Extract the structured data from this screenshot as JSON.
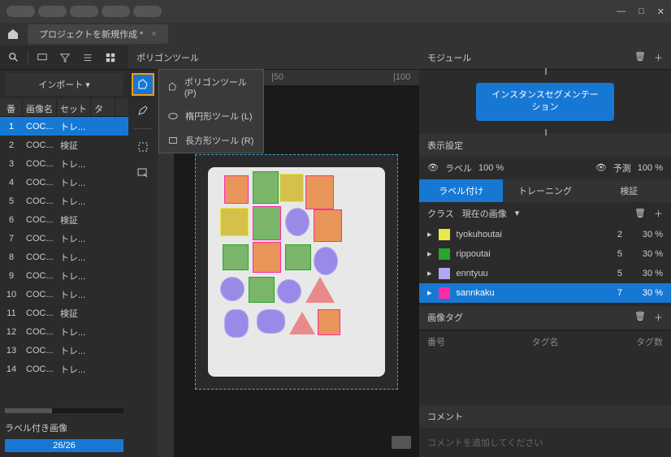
{
  "titlebar": {
    "min": "—",
    "max": "□",
    "close": "✕"
  },
  "tab": {
    "title": "プロジェクトを新規作成 *"
  },
  "left": {
    "import": "インポート ▾",
    "headers": {
      "num": "番号",
      "name": "画像名",
      "set": "セット",
      "tag": "タグ"
    },
    "rows": [
      {
        "n": "1",
        "name": "COC...",
        "set": "トレ...",
        "sel": true
      },
      {
        "n": "2",
        "name": "COC...",
        "set": "検証"
      },
      {
        "n": "3",
        "name": "COC...",
        "set": "トレ..."
      },
      {
        "n": "4",
        "name": "COC...",
        "set": "トレ..."
      },
      {
        "n": "5",
        "name": "COC...",
        "set": "トレ..."
      },
      {
        "n": "6",
        "name": "COC...",
        "set": "検証"
      },
      {
        "n": "7",
        "name": "COC...",
        "set": "トレ..."
      },
      {
        "n": "8",
        "name": "COC...",
        "set": "トレ..."
      },
      {
        "n": "9",
        "name": "COC...",
        "set": "トレ..."
      },
      {
        "n": "10",
        "name": "COC...",
        "set": "トレ..."
      },
      {
        "n": "11",
        "name": "COC...",
        "set": "検証"
      },
      {
        "n": "12",
        "name": "COC...",
        "set": "トレ..."
      },
      {
        "n": "13",
        "name": "COC...",
        "set": "トレ..."
      },
      {
        "n": "14",
        "name": "COC...",
        "set": "トレ..."
      }
    ],
    "footer": "ラベル付き画像",
    "progress": "26/26"
  },
  "center": {
    "toolname": "ポリゴンツール",
    "ruler": [
      "|50",
      "|100"
    ],
    "dropdown": [
      {
        "label": "ポリゴンツール (P)"
      },
      {
        "label": "楕円形ツール (L)"
      },
      {
        "label": "長方形ツール (R)"
      }
    ]
  },
  "right": {
    "module": "モジュール",
    "chip": "インスタンスセグメンテーション",
    "display": "表示設定",
    "label": "ラベル",
    "labelPct": "100 %",
    "pred": "予測",
    "predPct": "100 %",
    "tabs": {
      "a": "ラベル付け",
      "b": "トレーニング",
      "c": "検証"
    },
    "classLabel": "クラス",
    "classScope": "現在の画像",
    "classes": [
      {
        "color": "#e8e84a",
        "name": "tyokuhoutai",
        "cnt": "2",
        "pct": "30 %"
      },
      {
        "color": "#2aa52a",
        "name": "rippoutai",
        "cnt": "5",
        "pct": "30 %"
      },
      {
        "color": "#b0a8f0",
        "name": "enntyuu",
        "cnt": "5",
        "pct": "30 %"
      },
      {
        "color": "#ff2aa5",
        "name": "sannkaku",
        "cnt": "7",
        "pct": "30 %",
        "sel": true
      }
    ],
    "imgTag": "画像タグ",
    "tagCols": {
      "num": "番号",
      "name": "タグ名",
      "cnt": "タグ数"
    },
    "comment": "コメント",
    "commentPlaceholder": "コメントを追加してください"
  }
}
